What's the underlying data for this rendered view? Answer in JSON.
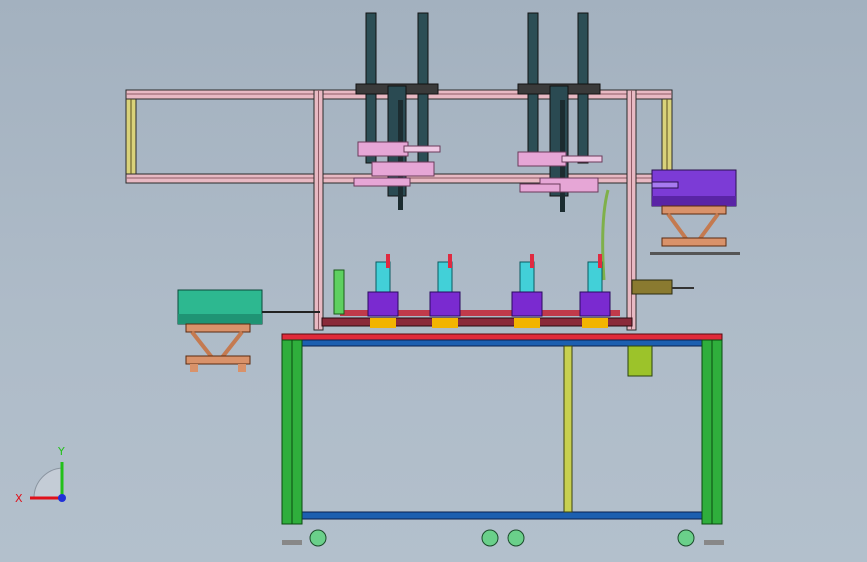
{
  "axes": {
    "x_label": "X",
    "y_label": "Y",
    "x_color": "#e0101a",
    "y_color": "#22c01a",
    "z_color": "#2030d8"
  },
  "colors": {
    "background": "#a8b6c4",
    "frame_pink": "#c98a95",
    "frame_dark": "#2a2a2a",
    "table_green": "#2fae3c",
    "table_blue": "#1c5fb0",
    "feeder_left": "#2db890",
    "feeder_right": "#7c3bd6",
    "motor_olive": "#9cc32a",
    "belt_teal": "#2c4e55",
    "cylinder_pink": "#e6a6d6",
    "copper": "#d9926a"
  }
}
